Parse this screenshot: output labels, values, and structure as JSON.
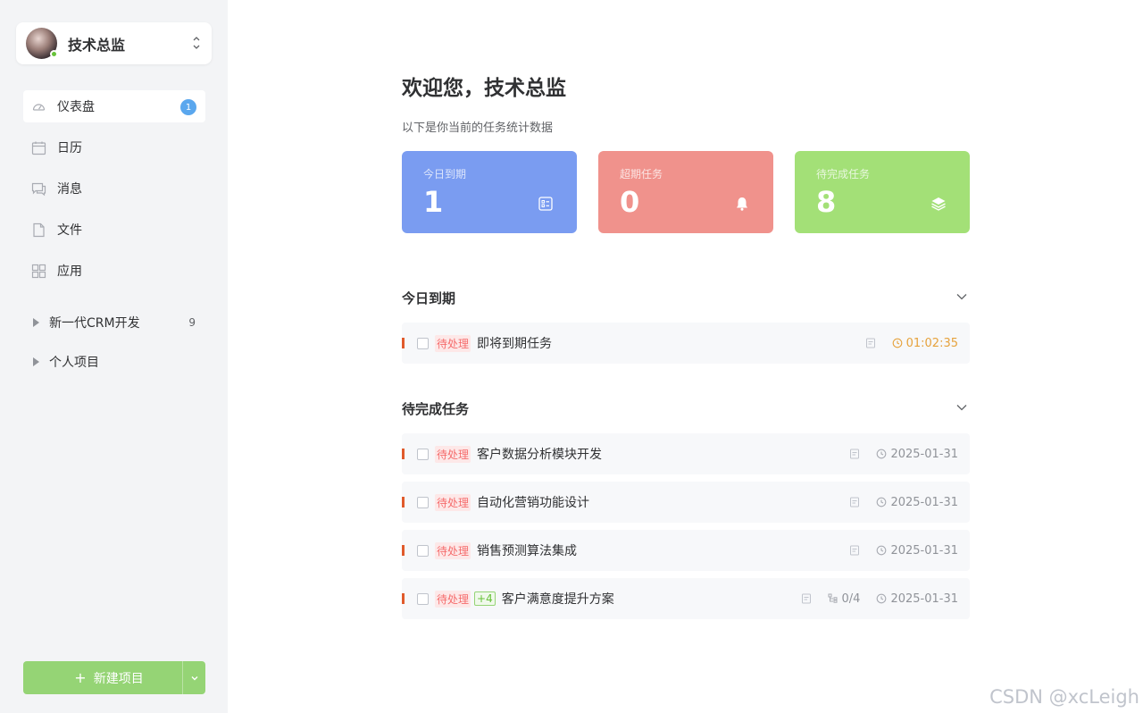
{
  "user": {
    "name": "技术总监"
  },
  "menu": [
    {
      "label": "仪表盘",
      "icon": "dashboard-icon",
      "badge": "1",
      "active": true
    },
    {
      "label": "日历",
      "icon": "calendar-icon"
    },
    {
      "label": "消息",
      "icon": "message-icon"
    },
    {
      "label": "文件",
      "icon": "file-icon"
    },
    {
      "label": "应用",
      "icon": "apps-icon"
    }
  ],
  "projects": [
    {
      "label": "新一代CRM开发",
      "count": "9"
    },
    {
      "label": "个人项目"
    }
  ],
  "new_project": {
    "label": "新建项目"
  },
  "header": {
    "welcome": "欢迎您，技术总监",
    "subtitle": "以下是你当前的任务统计数据"
  },
  "stats": [
    {
      "label": "今日到期",
      "value": "1",
      "color": "#7a9cf1",
      "icon": "task-list-icon"
    },
    {
      "label": "超期任务",
      "value": "0",
      "color": "#f0928c",
      "icon": "bell-icon"
    },
    {
      "label": "待完成任务",
      "value": "8",
      "color": "#a3e077",
      "icon": "layers-icon"
    }
  ],
  "sections": {
    "today": {
      "title": "今日到期",
      "tasks": [
        {
          "status": "待处理",
          "title": "即将到期任务",
          "time": "01:02:35"
        }
      ]
    },
    "pending": {
      "title": "待完成任务",
      "tasks": [
        {
          "status": "待处理",
          "title": "客户数据分析模块开发",
          "date": "2025-01-31"
        },
        {
          "status": "待处理",
          "title": "自动化营销功能设计",
          "date": "2025-01-31"
        },
        {
          "status": "待处理",
          "title": "销售预测算法集成",
          "date": "2025-01-31"
        },
        {
          "status": "待处理",
          "extra_tag": "+4",
          "title": "客户满意度提升方案",
          "subtasks": "0/4",
          "date": "2025-01-31"
        }
      ]
    }
  },
  "colors": {
    "accent_green": "#95d475",
    "status_red": "#f56c6c",
    "urgent_orange": "#e6a23c",
    "priority_bar": "#e05a2b"
  },
  "watermark": "CSDN @xcLeigh"
}
